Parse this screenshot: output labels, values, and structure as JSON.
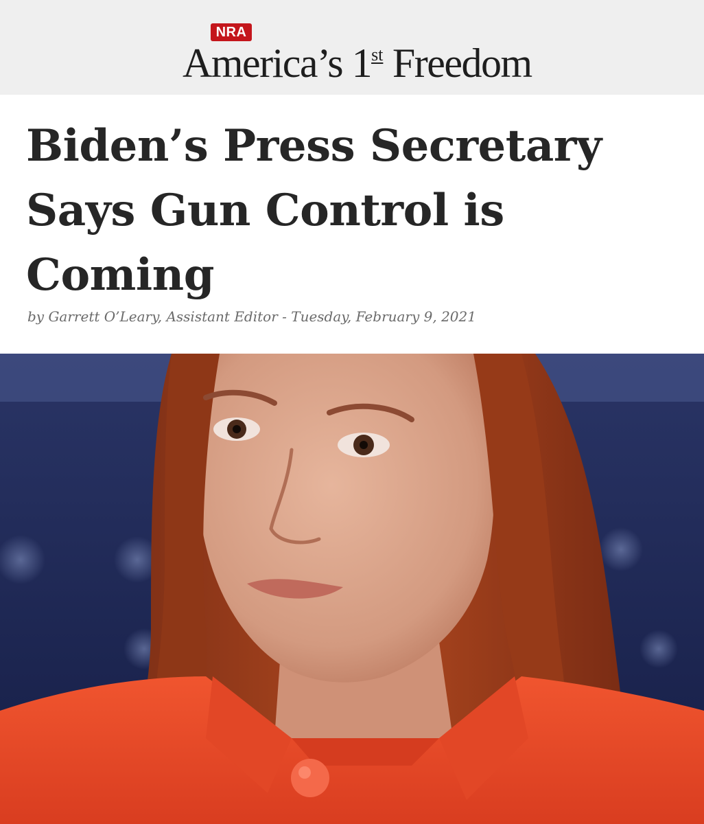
{
  "masthead": {
    "badge": "NRA",
    "title_main": "America’s 1",
    "title_sup": "st",
    "title_end": "Freedom"
  },
  "article": {
    "title_line_1": "Biden’s Press Secretary",
    "title_line_2": "Says Gun Control is",
    "title_line_3": "Coming",
    "byline": "by Garrett O’Leary, Assistant Editor - Tuesday, February 9, 2021"
  },
  "colors": {
    "brand_red": "#c4161c",
    "masthead_bg": "#efefef",
    "headline": "#262626",
    "byline": "#6a6a6a",
    "photo_background": "#1b2553",
    "jacket": "#e84a2a",
    "hair": "#a8431f"
  }
}
